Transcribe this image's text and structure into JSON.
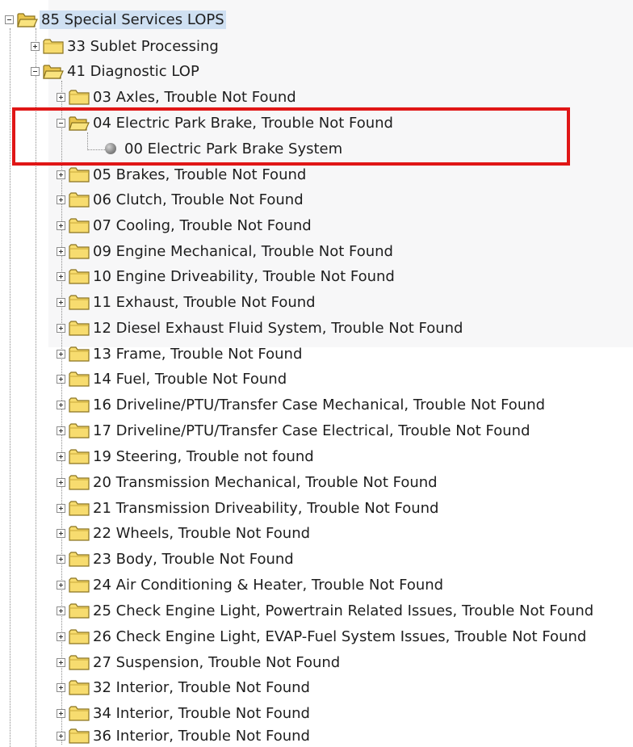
{
  "tree": {
    "root": {
      "label": "85 Special Services LOPS"
    },
    "sublet": {
      "label": "33 Sublet Processing"
    },
    "diagnostic": {
      "label": "41 Diagnostic LOP"
    },
    "axles": {
      "label": "03 Axles, Trouble Not Found"
    },
    "epb": {
      "label": "04 Electric Park Brake, Trouble Not Found"
    },
    "epb_child": {
      "label": "00 Electric Park Brake System"
    },
    "items": [
      "05 Brakes, Trouble Not Found",
      "06 Clutch, Trouble Not Found",
      "07 Cooling, Trouble Not Found",
      "09 Engine Mechanical, Trouble Not Found",
      "10 Engine Driveability, Trouble Not Found",
      "11 Exhaust, Trouble Not Found",
      "12 Diesel Exhaust Fluid System, Trouble Not Found",
      "13 Frame, Trouble Not Found",
      "14 Fuel, Trouble Not Found",
      "16 Driveline/PTU/Transfer Case Mechanical, Trouble Not Found",
      "17 Driveline/PTU/Transfer Case Electrical, Trouble Not Found",
      "19 Steering, Trouble not found",
      "20 Transmission Mechanical, Trouble Not Found",
      "21 Transmission Driveability, Trouble Not Found",
      "22 Wheels, Trouble Not Found",
      "23 Body, Trouble Not Found",
      "24 Air Conditioning & Heater, Trouble Not Found",
      "25 Check Engine Light, Powertrain Related Issues, Trouble Not Found",
      "26 Check Engine Light, EVAP-Fuel System Issues, Trouble Not Found",
      "27 Suspension, Trouble Not Found",
      "32 Interior, Trouble Not Found",
      "34 Interior, Trouble Not Found",
      "36 Interior, Trouble Not Found"
    ]
  },
  "colors": {
    "highlight_border": "#e01616",
    "selection_bg": "#cfe0f2",
    "folder_fill": "#f7dc6f"
  },
  "icons": {
    "folder_closed": "folder-icon",
    "folder_open": "folder-open-icon",
    "item": "sphere-item-icon",
    "expand": "plus-box-icon",
    "collapse": "minus-box-icon"
  }
}
